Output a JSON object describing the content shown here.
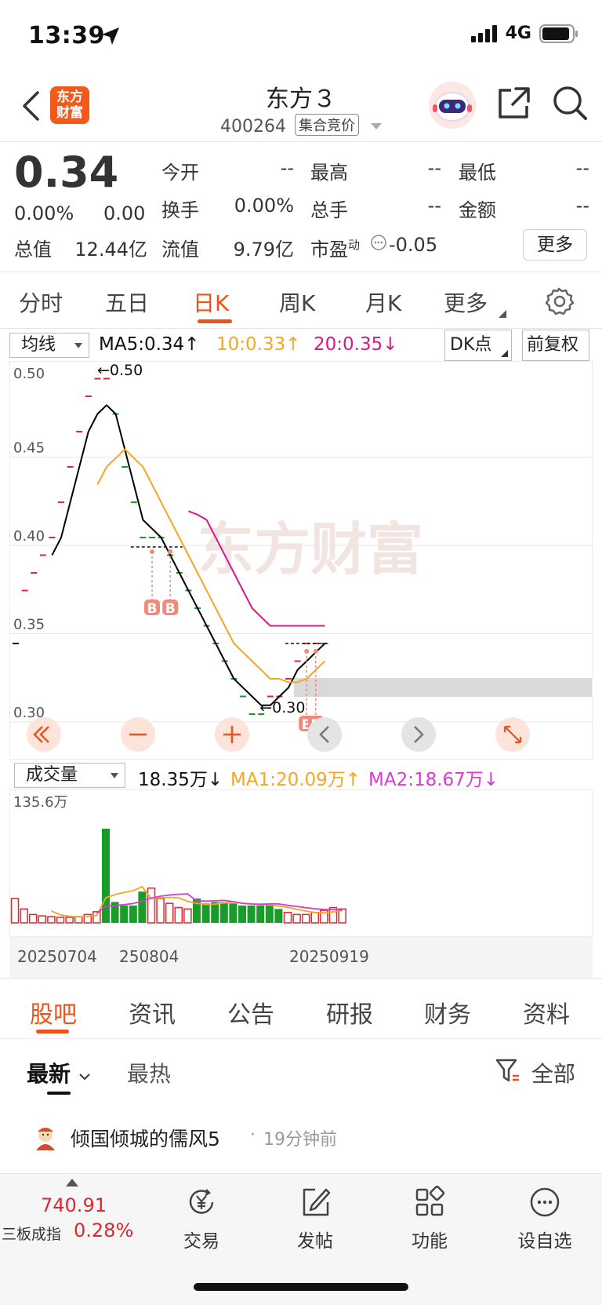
{
  "status": {
    "time": "13:39",
    "network": "4G"
  },
  "header": {
    "logo_line1": "东方",
    "logo_line2": "财富",
    "stock_name": "东方３",
    "stock_code": "400264",
    "auction_tag": "集合竞价"
  },
  "quote": {
    "price": "0.34",
    "change_pct": "0.00%",
    "change_amt": "0.00",
    "items": [
      {
        "label": "今开",
        "value": "--"
      },
      {
        "label": "最高",
        "value": "--"
      },
      {
        "label": "最低",
        "value": "--"
      },
      {
        "label": "换手",
        "value": "0.00%"
      },
      {
        "label": "总手",
        "value": "--"
      },
      {
        "label": "金额",
        "value": "--"
      }
    ],
    "total_value_label": "总值",
    "total_value": "12.44亿",
    "float_value_label": "流值",
    "float_value": "9.79亿",
    "pe_label": "市盈",
    "pe_superscript": "动",
    "pe_value": "-0.05",
    "more_label": "更多"
  },
  "period_tabs": [
    "分时",
    "五日",
    "日K",
    "周K",
    "月K",
    "更多"
  ],
  "active_period": "日K",
  "ma": {
    "select_label": "均线",
    "ma5": "MA5:0.34↑",
    "ma10": "10:0.33↑",
    "ma20": "20:0.35↓",
    "dk_label": "DK点",
    "adjust_label": "前复权"
  },
  "chart_data": [
    {
      "type": "line",
      "title": "",
      "y_ticks": [
        "0.50",
        "0.45",
        "0.40",
        "0.35",
        "0.30"
      ],
      "ylim": [
        0.3,
        0.5
      ],
      "high_marker": "←0.50",
      "low_marker": "←0.30",
      "watermark": "东方财富",
      "signal_labels": [
        "B",
        "B",
        "B",
        "B"
      ],
      "x": [
        1,
        2,
        3,
        4,
        5,
        6,
        7,
        8,
        9,
        10,
        11,
        12,
        13,
        14,
        15,
        16,
        17,
        18,
        19,
        20,
        21,
        22,
        23,
        24,
        25,
        26,
        27,
        28,
        29,
        30,
        31,
        32,
        33,
        34,
        35
      ],
      "candles_close": [
        0.34,
        0.37,
        0.38,
        0.39,
        0.4,
        0.42,
        0.44,
        0.46,
        0.48,
        0.49,
        0.49,
        0.47,
        0.44,
        0.42,
        0.4,
        0.4,
        0.4,
        0.39,
        0.38,
        0.37,
        0.36,
        0.35,
        0.34,
        0.33,
        0.32,
        0.31,
        0.3,
        0.3,
        0.31,
        0.31,
        0.32,
        0.33,
        0.34,
        0.34,
        0.34
      ],
      "series": [
        {
          "name": "MA5",
          "color": "#000000",
          "values": [
            null,
            null,
            null,
            null,
            0.39,
            0.4,
            0.42,
            0.44,
            0.46,
            0.47,
            0.475,
            0.47,
            0.45,
            0.43,
            0.41,
            0.405,
            0.4,
            0.39,
            0.38,
            0.37,
            0.36,
            0.35,
            0.34,
            0.33,
            0.32,
            0.315,
            0.31,
            0.305,
            0.305,
            0.31,
            0.315,
            0.325,
            0.33,
            0.335,
            0.34
          ]
        },
        {
          "name": "MA10",
          "color": "#f5a623",
          "values": [
            null,
            null,
            null,
            null,
            null,
            null,
            null,
            null,
            null,
            0.43,
            0.44,
            0.445,
            0.45,
            0.445,
            0.44,
            0.43,
            0.42,
            0.41,
            0.4,
            0.39,
            0.38,
            0.37,
            0.36,
            0.35,
            0.34,
            0.335,
            0.33,
            0.325,
            0.32,
            0.32,
            0.318,
            0.318,
            0.32,
            0.325,
            0.33
          ]
        },
        {
          "name": "MA20",
          "color": "#d6198b",
          "values": [
            null,
            null,
            null,
            null,
            null,
            null,
            null,
            null,
            null,
            null,
            null,
            null,
            null,
            null,
            null,
            null,
            null,
            null,
            null,
            0.415,
            0.413,
            0.41,
            0.4,
            0.39,
            0.38,
            0.37,
            0.36,
            0.355,
            0.35,
            0.35,
            0.35,
            0.35,
            0.35,
            0.35,
            0.35
          ]
        }
      ]
    },
    {
      "type": "bar",
      "title": "",
      "y_max_label": "135.6万",
      "x_labels": [
        "20250704",
        "250804",
        "20250919"
      ],
      "volumes": [
        35,
        20,
        12,
        10,
        9,
        8,
        8,
        9,
        12,
        16,
        135.6,
        30,
        25,
        25,
        45,
        50,
        35,
        28,
        22,
        20,
        35,
        28,
        30,
        30,
        28,
        25,
        25,
        25,
        26,
        20,
        15,
        12,
        12,
        15,
        18,
        22,
        20
      ],
      "up_flags": [
        1,
        1,
        1,
        1,
        1,
        1,
        1,
        1,
        1,
        1,
        0,
        0,
        0,
        0,
        0,
        1,
        1,
        1,
        1,
        1,
        0,
        0,
        0,
        0,
        0,
        0,
        0,
        0,
        0,
        0,
        1,
        1,
        1,
        1,
        1,
        1,
        1
      ],
      "series": [
        {
          "name": "MA1",
          "color": "#f5a623"
        },
        {
          "name": "MA2",
          "color": "#d63bd6"
        }
      ]
    }
  ],
  "volume": {
    "select_label": "成交量",
    "current": "18.35万↓",
    "ma1": "MA1:20.09万↑",
    "ma2": "MA2:18.67万↓"
  },
  "content_tabs": [
    "股吧",
    "资讯",
    "公告",
    "研报",
    "财务",
    "资料"
  ],
  "active_content_tab": "股吧",
  "sort": {
    "latest": "最新",
    "hottest": "最热",
    "filter_label": "全部"
  },
  "post": {
    "author": "倾国倾城的儒风5",
    "time": "19分钟前"
  },
  "index": {
    "value": "740.91",
    "name": "三板成指",
    "change": "0.28%"
  },
  "bottom_nav": [
    "交易",
    "发帖",
    "功能",
    "设自选"
  ]
}
